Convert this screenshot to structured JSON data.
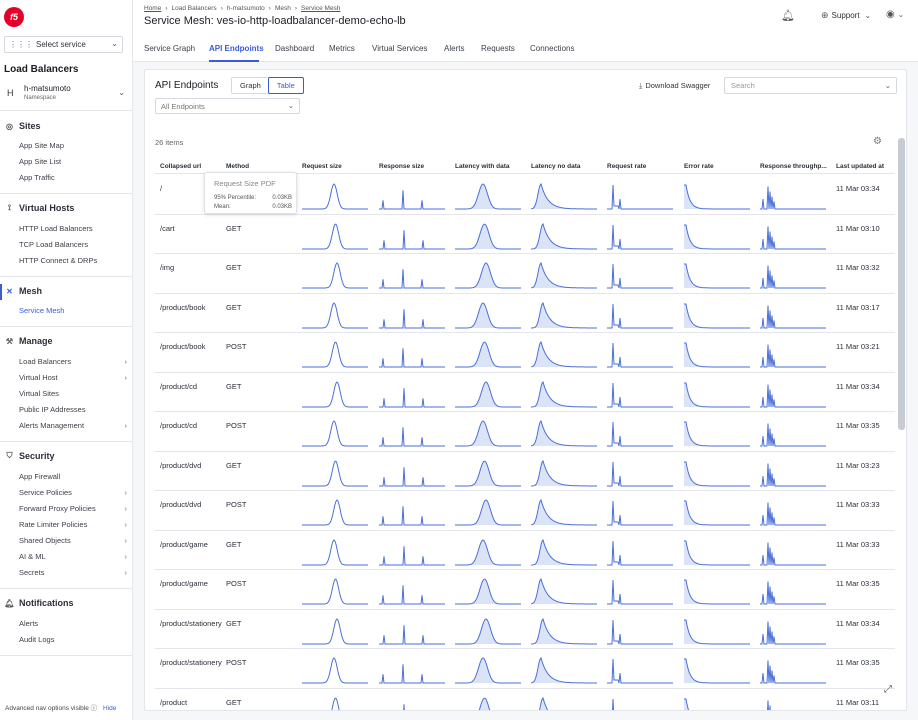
{
  "sidebar": {
    "logo": "f5",
    "select_service": "Select service",
    "workspace_title": "Load Balancers",
    "namespace": {
      "avatar": "H",
      "name": "h-matsumoto",
      "label": "Namespace"
    },
    "sections": [
      {
        "title": "Sites",
        "icon": "globe-icon",
        "items": [
          {
            "label": "App Site Map"
          },
          {
            "label": "App Site List"
          },
          {
            "label": "App Traffic"
          }
        ]
      },
      {
        "title": "Virtual Hosts",
        "icon": "virtual-hosts-icon",
        "items": [
          {
            "label": "HTTP Load Balancers"
          },
          {
            "label": "TCP Load Balancers"
          },
          {
            "label": "HTTP Connect & DRPs"
          }
        ]
      },
      {
        "title": "Mesh",
        "icon": "mesh-icon",
        "items": [
          {
            "label": "Service Mesh"
          }
        ]
      },
      {
        "title": "Manage",
        "icon": "wrench-icon",
        "items": [
          {
            "label": "Load Balancers"
          },
          {
            "label": "Virtual Host"
          },
          {
            "label": "Virtual Sites"
          },
          {
            "label": "Public IP Addresses"
          },
          {
            "label": "Alerts Management"
          }
        ]
      },
      {
        "title": "Security",
        "icon": "shield-icon",
        "items": [
          {
            "label": "App Firewall"
          },
          {
            "label": "Service Policies"
          },
          {
            "label": "Forward Proxy Policies"
          },
          {
            "label": "Rate Limiter Policies"
          },
          {
            "label": "Shared Objects"
          },
          {
            "label": "AI & ML"
          },
          {
            "label": "Secrets"
          }
        ]
      },
      {
        "title": "Notifications",
        "icon": "bell-icon",
        "items": [
          {
            "label": "Alerts"
          },
          {
            "label": "Audit Logs"
          }
        ]
      }
    ],
    "bottom_note": "Advanced nav options visible",
    "hide_label": "Hide"
  },
  "header": {
    "breadcrumb": [
      "Home",
      "Load Balancers",
      "h-matsumoto",
      "Mesh",
      "Service Mesh"
    ],
    "title": "Service Mesh: ves-io-http-loadbalancer-demo-echo-lb",
    "support_label": "Support"
  },
  "tabs": [
    {
      "label": "Service Graph"
    },
    {
      "label": "API Endpoints"
    },
    {
      "label": "Dashboard"
    },
    {
      "label": "Metrics"
    },
    {
      "label": "Virtual Services"
    },
    {
      "label": "Alerts"
    },
    {
      "label": "Requests"
    },
    {
      "label": "Connections"
    }
  ],
  "active_tab": "API Endpoints",
  "panel": {
    "title": "API Endpoints",
    "view_graph": "Graph",
    "view_table": "Table",
    "download": "Download Swagger",
    "search_placeholder": "Search",
    "endpoint_filter": "All Endpoints",
    "item_count": "26 items"
  },
  "table": {
    "columns": [
      "Collapsed url",
      "Method",
      "Request size",
      "Response size",
      "Latency with data",
      "Latency no data",
      "Request rate",
      "Error rate",
      "Response throughp...",
      "Last updated at"
    ],
    "rows": [
      {
        "url": "/",
        "method": "",
        "updated": "11 Mar 03:34"
      },
      {
        "url": "/cart",
        "method": "GET",
        "updated": "11 Mar 03:10"
      },
      {
        "url": "/img",
        "method": "GET",
        "updated": "11 Mar 03:32"
      },
      {
        "url": "/product/book",
        "method": "GET",
        "updated": "11 Mar 03:17"
      },
      {
        "url": "/product/book",
        "method": "POST",
        "updated": "11 Mar 03:21"
      },
      {
        "url": "/product/cd",
        "method": "GET",
        "updated": "11 Mar 03:34"
      },
      {
        "url": "/product/cd",
        "method": "POST",
        "updated": "11 Mar 03:35"
      },
      {
        "url": "/product/dvd",
        "method": "GET",
        "updated": "11 Mar 03:23"
      },
      {
        "url": "/product/dvd",
        "method": "POST",
        "updated": "11 Mar 03:33"
      },
      {
        "url": "/product/game",
        "method": "GET",
        "updated": "11 Mar 03:33"
      },
      {
        "url": "/product/game",
        "method": "POST",
        "updated": "11 Mar 03:35"
      },
      {
        "url": "/product/stationery",
        "method": "GET",
        "updated": "11 Mar 03:34"
      },
      {
        "url": "/product/stationery",
        "method": "POST",
        "updated": "11 Mar 03:35"
      },
      {
        "url": "/product",
        "method": "GET",
        "updated": "11 Mar 03:11"
      }
    ]
  },
  "tooltip": {
    "title": "Request Size PDF",
    "p95_label": "95% Percentile:",
    "p95_value": "0.03KB",
    "mean_label": "Mean:",
    "mean_value": "0.03KB"
  },
  "colors": {
    "accent": "#3b5bdb",
    "spark_line": "#4a6fd8",
    "spark_fill": "#dbe3f7",
    "brand": "#e4002b"
  }
}
